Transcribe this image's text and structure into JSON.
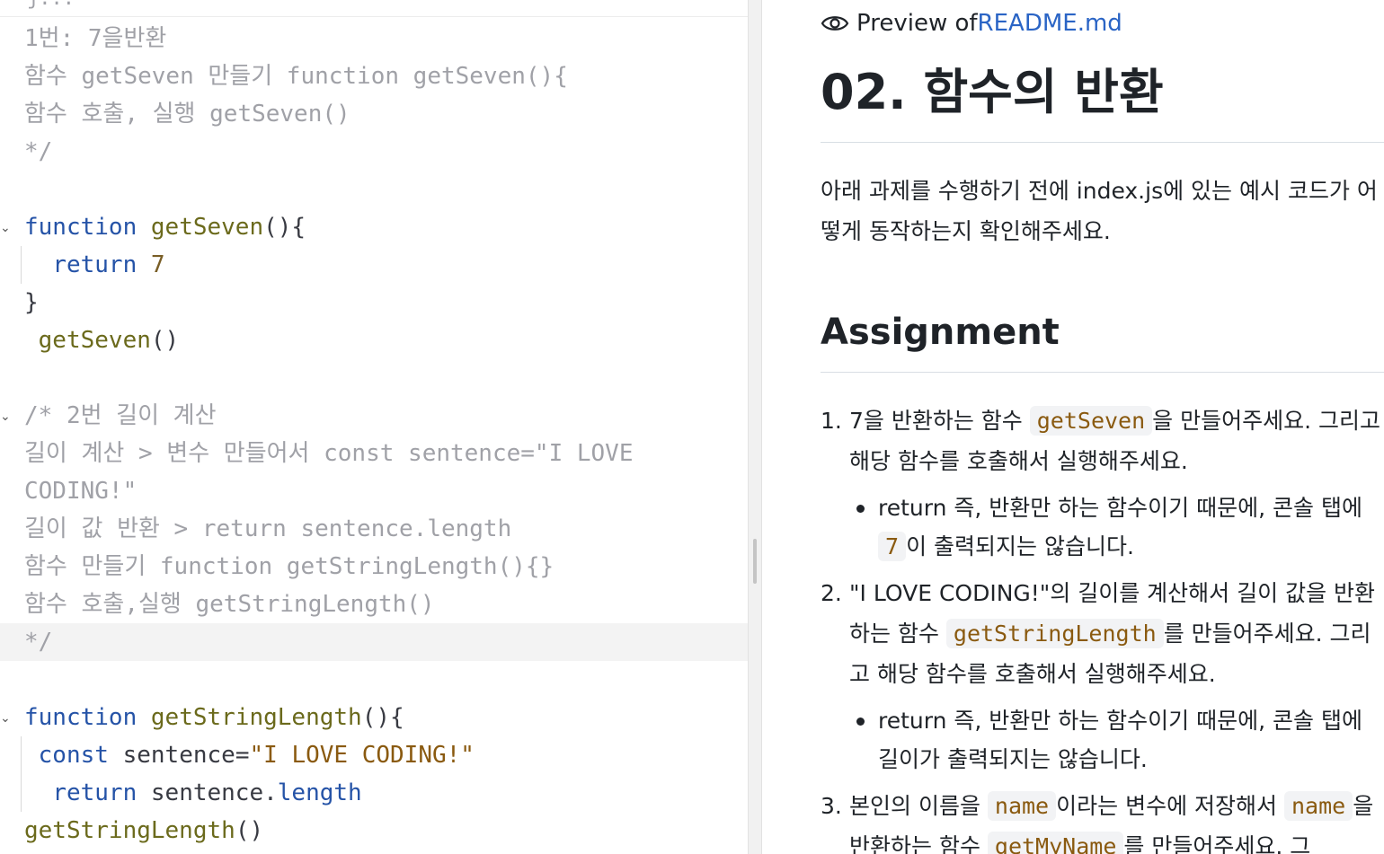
{
  "editor": {
    "peek_text": "j...",
    "lines": [
      [
        {
          "t": "1번: 7을반환",
          "c": "comment"
        }
      ],
      [
        {
          "t": "함수 getSeven 만들기 function getSeven(){",
          "c": "comment"
        }
      ],
      [
        {
          "t": "함수 호출, 실행 getSeven()",
          "c": "comment"
        }
      ],
      [
        {
          "t": "*/",
          "c": "comment"
        }
      ],
      [],
      [
        {
          "t": "function",
          "c": "kw"
        },
        {
          "t": " ",
          "c": "plain"
        },
        {
          "t": "getSeven",
          "c": "fn"
        },
        {
          "t": "(){",
          "c": "plain"
        }
      ],
      [
        {
          "t": "  ",
          "c": "plain"
        },
        {
          "t": "return",
          "c": "kw"
        },
        {
          "t": " ",
          "c": "plain"
        },
        {
          "t": "7",
          "c": "num"
        }
      ],
      [
        {
          "t": "}",
          "c": "plain"
        }
      ],
      [
        {
          "t": " ",
          "c": "plain"
        },
        {
          "t": "getSeven",
          "c": "fn"
        },
        {
          "t": "()",
          "c": "plain"
        }
      ],
      [],
      [
        {
          "t": "/* 2번 길이 계산",
          "c": "comment"
        }
      ],
      [
        {
          "t": "길이 계산 > 변수 만들어서 const sentence=\"I LOVE",
          "c": "comment"
        }
      ],
      [
        {
          "t": "CODING!\"",
          "c": "comment"
        }
      ],
      [
        {
          "t": "길이 값 반환 > return sentence.length",
          "c": "comment"
        }
      ],
      [
        {
          "t": "함수 만들기 function getStringLength(){}",
          "c": "comment"
        }
      ],
      [
        {
          "t": "함수 호출,실행 getStringLength()",
          "c": "comment"
        }
      ],
      [
        {
          "t": "*/",
          "c": "comment"
        }
      ],
      [],
      [
        {
          "t": "function",
          "c": "kw"
        },
        {
          "t": " ",
          "c": "plain"
        },
        {
          "t": "getStringLength",
          "c": "fn"
        },
        {
          "t": "(){",
          "c": "plain"
        }
      ],
      [
        {
          "t": " ",
          "c": "plain"
        },
        {
          "t": "const",
          "c": "kw"
        },
        {
          "t": " sentence=",
          "c": "plain"
        },
        {
          "t": "\"I LOVE CODING!\"",
          "c": "str"
        }
      ],
      [
        {
          "t": "  ",
          "c": "plain"
        },
        {
          "t": "return",
          "c": "kw"
        },
        {
          "t": " sentence.",
          "c": "plain"
        },
        {
          "t": "length",
          "c": "prop"
        }
      ],
      [
        {
          "t": "getStringLength",
          "c": "fn squiggle"
        },
        {
          "t": "()",
          "c": "plain"
        }
      ]
    ]
  },
  "preview": {
    "header_prefix": "Preview of ",
    "header_file": "README.md",
    "title": "02. 함수의 반환",
    "intro": "아래 과제를 수행하기 전에 index.js에 있는 예시 코드가 어떻게 동작하는지 확인해주세요.",
    "assignment_heading": "Assignment",
    "tasks": [
      {
        "num": "1.",
        "parts": [
          {
            "t": "7을 반환하는 함수 "
          },
          {
            "t": "getSeven",
            "code": true
          },
          {
            "t": "을 만들어주세요. 그리고 해당 함수를 호출해서 실행해주세요."
          }
        ],
        "sub": [
          [
            {
              "t": "return 즉, 반환만 하는 함수이기 때문에, 콘솔 탭에 "
            },
            {
              "t": "7",
              "code": true
            },
            {
              "t": "이 출력되지는 않습니다."
            }
          ]
        ]
      },
      {
        "num": "2.",
        "parts": [
          {
            "t": "\"I LOVE CODING!\"의 길이를 계산해서 길이 값을 반환하는 함수 "
          },
          {
            "t": "getStringLength",
            "code": true
          },
          {
            "t": "를 만들어주세요. 그리고 해당 함수를 호출해서 실행해주세요."
          }
        ],
        "sub": [
          [
            {
              "t": "return 즉, 반환만 하는 함수이기 때문에, 콘솔 탭에 길이가 출력되지는 않습니다."
            }
          ]
        ]
      },
      {
        "num": "3.",
        "parts": [
          {
            "t": "본인의 이름을 "
          },
          {
            "t": "name",
            "code": true
          },
          {
            "t": "이라는 변수에 저장해서 "
          },
          {
            "t": "name",
            "code": true
          },
          {
            "t": "을 반환하는 함수 "
          },
          {
            "t": "getMyName",
            "code": true
          },
          {
            "t": "를 만들어주세요. 그"
          }
        ],
        "sub": []
      }
    ]
  },
  "colors": {
    "keyword": "#2553a7",
    "function": "#6b6a1c",
    "comment": "#a0a1a7",
    "string": "#8a5a10",
    "link": "#2a64c5"
  },
  "icons": {
    "preview": "eye-icon",
    "fold": "chevron-down-icon"
  }
}
